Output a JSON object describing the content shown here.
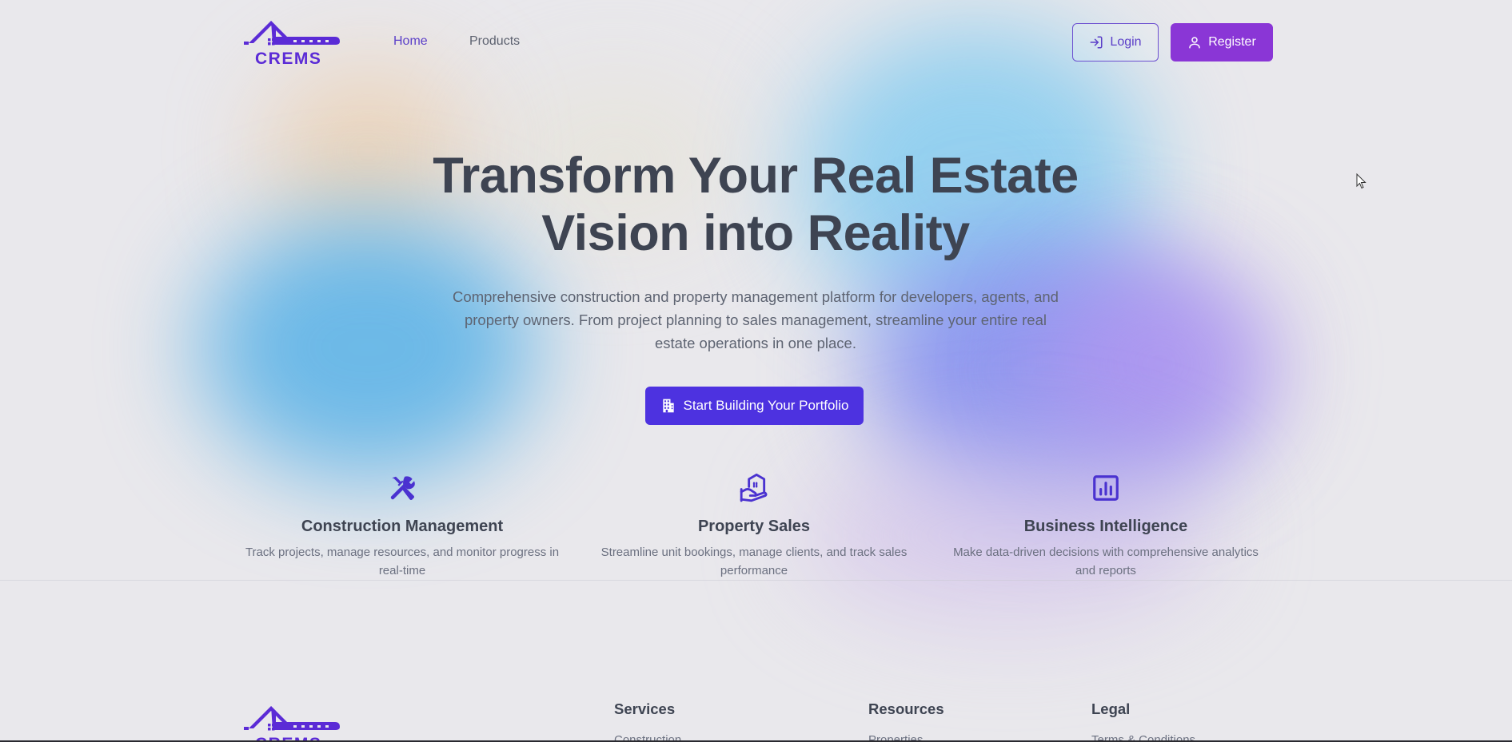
{
  "brand": {
    "name": "CREMS",
    "color": "#5b2bd6"
  },
  "nav": {
    "home": "Home",
    "products": "Products",
    "login": "Login",
    "register": "Register"
  },
  "hero": {
    "title_line1": "Transform Your Real Estate",
    "title_line2": "Vision into Reality",
    "subtitle": "Comprehensive construction and property management platform for developers, agents, and property owners. From project planning to sales management, streamline your entire real estate operations in one place.",
    "cta": "Start Building Your Portfolio"
  },
  "features": [
    {
      "icon": "tools-icon",
      "title": "Construction Management",
      "desc": "Track projects, manage resources, and monitor progress in real-time"
    },
    {
      "icon": "house-hand-icon",
      "title": "Property Sales",
      "desc": "Streamline unit bookings, manage clients, and track sales performance"
    },
    {
      "icon": "bar-chart-icon",
      "title": "Business Intelligence",
      "desc": "Make data-driven decisions with comprehensive analytics and reports"
    }
  ],
  "footer": {
    "columns": [
      {
        "heading": "Services",
        "first_link": "Construction"
      },
      {
        "heading": "Resources",
        "first_link": "Properties"
      },
      {
        "heading": "Legal",
        "first_link": "Terms & Conditions"
      }
    ]
  },
  "colors": {
    "accent": "#5b3fc8",
    "register_bg": "#8a36d6",
    "cta_bg": "#4d32e0",
    "icon": "#4a32d0"
  }
}
